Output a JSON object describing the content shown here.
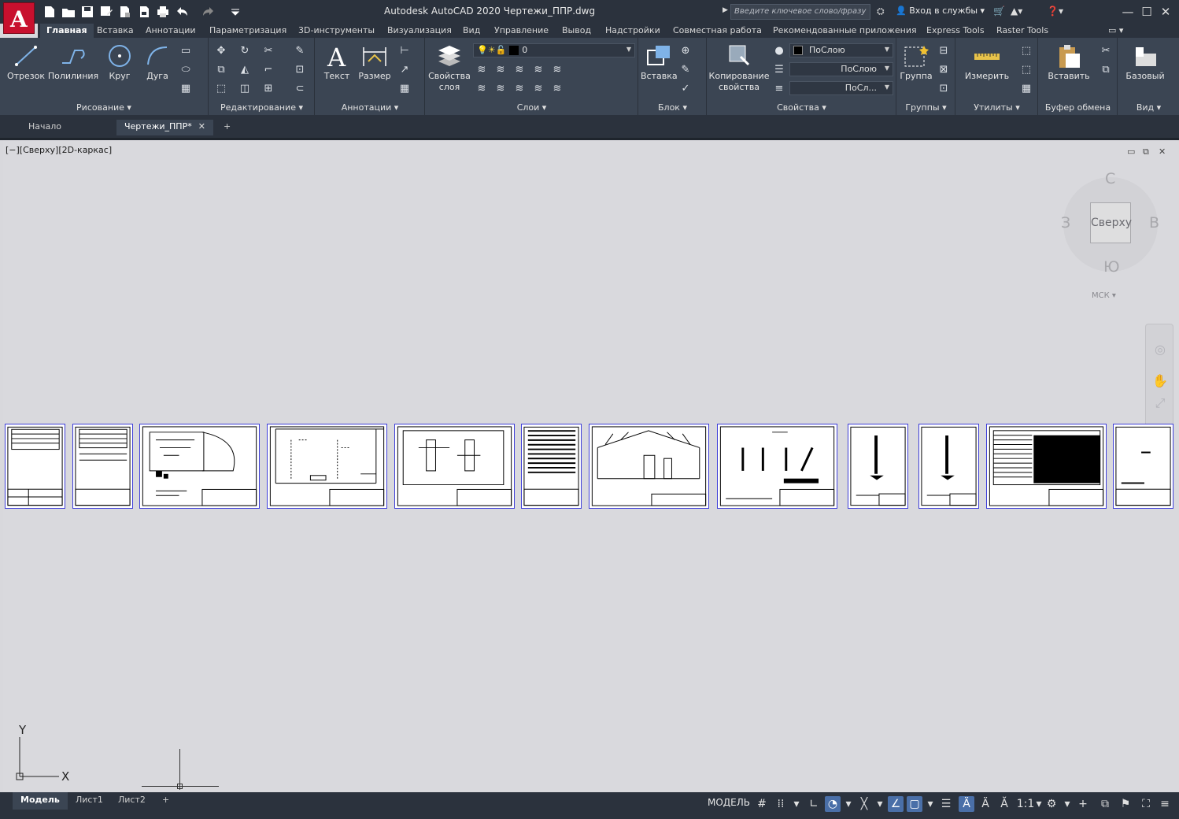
{
  "titlebar": {
    "app_letter": "A",
    "title": "Autodesk AutoCAD 2020    Чертежи_ППР.dwg",
    "search_placeholder": "Введите ключевое слово/фразу",
    "login": "Вход в службы",
    "minimize": "—",
    "maximize": "☐",
    "close": "✕"
  },
  "ribbon_tabs": [
    "Главная",
    "Вставка",
    "Аннотации",
    "Параметризация",
    "3D-инструменты",
    "Визуализация",
    "Вид",
    "Управление",
    "Вывод",
    "Надстройки",
    "Совместная работа",
    "Рекомендованные приложения",
    "Express Tools",
    "Raster Tools"
  ],
  "ribbon": {
    "draw": {
      "title": "Рисование",
      "line": "Отрезок",
      "polyline": "Полилиния",
      "circle": "Круг",
      "arc": "Дуга"
    },
    "modify": {
      "title": "Редактирование"
    },
    "annotation": {
      "title": "Аннотации",
      "text": "Текст",
      "dimension": "Размер"
    },
    "layers": {
      "title": "Слои",
      "props": "Свойства слоя",
      "layer_value": "0"
    },
    "block": {
      "title": "Блок",
      "insert": "Вставка"
    },
    "properties": {
      "title": "Свойства",
      "match": "Копирование свойства",
      "color": "ПоСлою",
      "linetype": "ПоСлою",
      "lineweight": "ПоСл..."
    },
    "groups": {
      "title": "Группы",
      "group": "Группа"
    },
    "utilities": {
      "title": "Утилиты",
      "measure": "Измерить"
    },
    "clipboard": {
      "title": "Буфер обмена",
      "paste": "Вставить"
    },
    "view": {
      "title": "Вид",
      "base": "Базовый"
    }
  },
  "doc_tabs": {
    "start": "Начало",
    "active": "Чертежи_ППР*",
    "close": "✕",
    "add": "+"
  },
  "viewport": {
    "label": "[−][Сверху][2D-каркас]",
    "cube_face": "Сверху",
    "north": "С",
    "south": "Ю",
    "west": "З",
    "east": "В",
    "wcs": "МСК"
  },
  "ucs": {
    "x": "X",
    "y": "Y"
  },
  "layout_tabs": [
    "Модель",
    "Лист1",
    "Лист2"
  ],
  "layout_add": "+",
  "status": {
    "model": "МОДЕЛЬ",
    "scale": "1:1"
  }
}
